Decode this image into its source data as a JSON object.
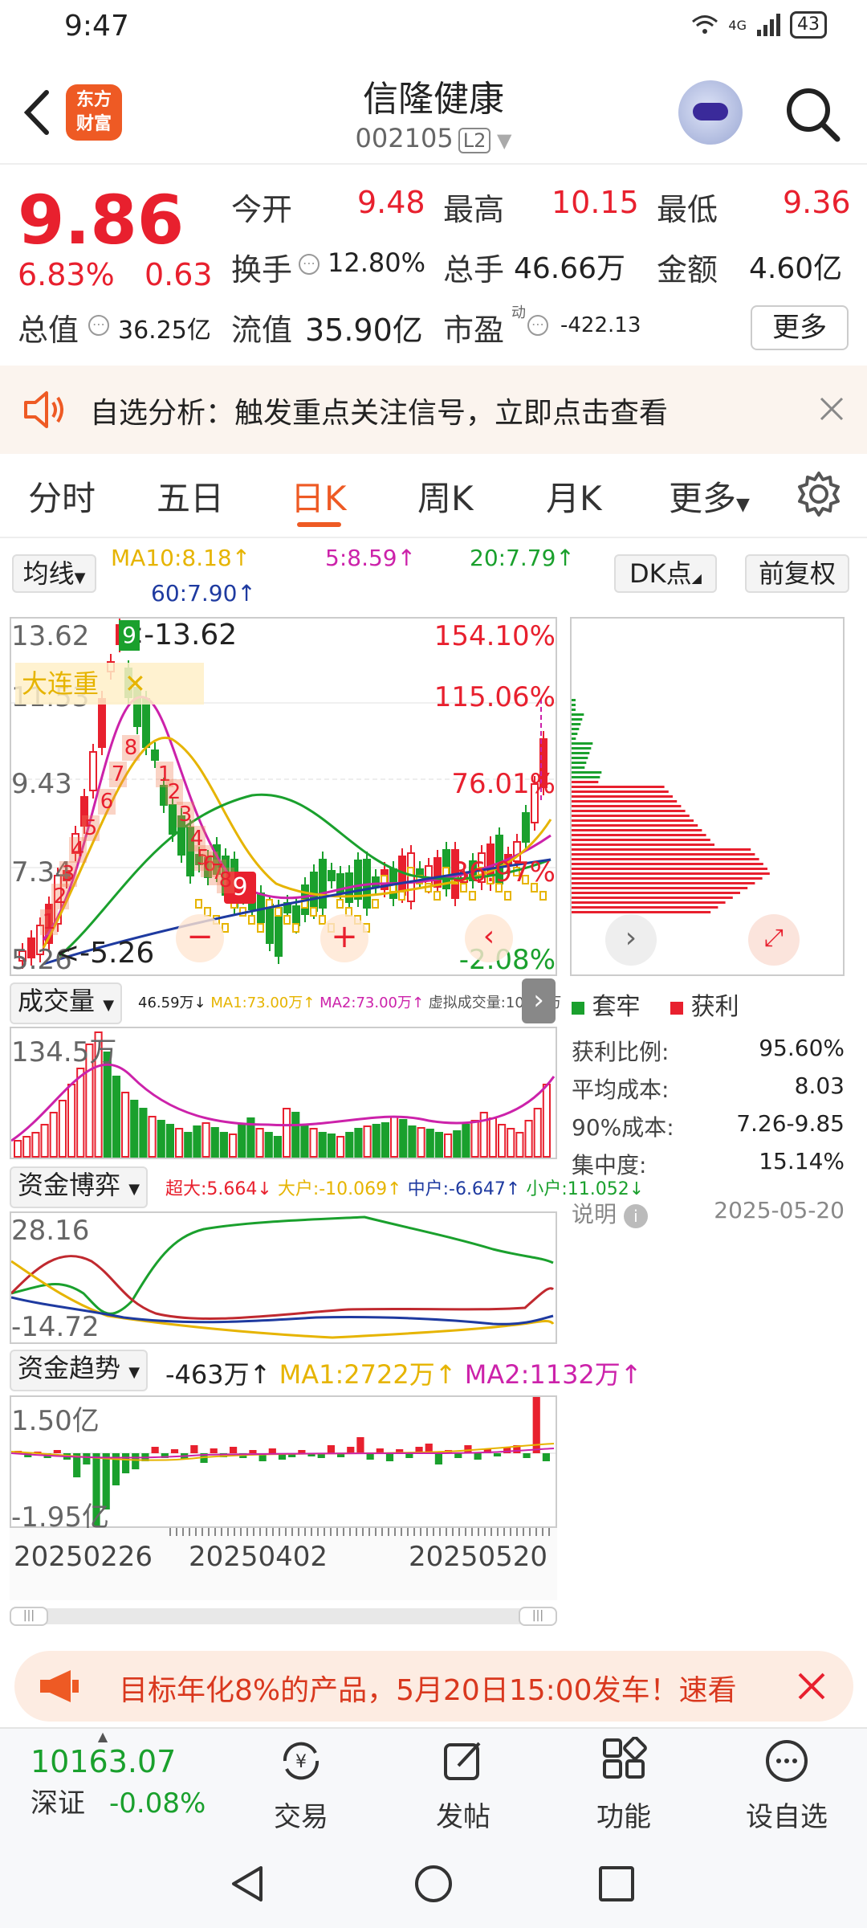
{
  "status": {
    "time": "9:47",
    "network": "4G",
    "battery": "43"
  },
  "header": {
    "logo_line1": "东方",
    "logo_line2": "财富",
    "stock_name": "信隆健康",
    "stock_code": "002105",
    "level": "L2"
  },
  "quote": {
    "price": "9.86",
    "change_pct": "6.83%",
    "change": "0.63",
    "open_label": "今开",
    "open": "9.48",
    "high_label": "最高",
    "high": "10.15",
    "low_label": "最低",
    "low": "9.36",
    "turnover_label": "换手",
    "turnover": "12.80%",
    "volume_label": "总手",
    "volume": "46.66万",
    "amount_label": "金额",
    "amount": "4.60亿",
    "mktcap_label": "总值",
    "mktcap": "36.25亿",
    "float_label": "流值",
    "float": "35.90亿",
    "pe_label": "市盈",
    "pe_sup": "动",
    "pe": "-422.13",
    "more_label": "更多"
  },
  "banner1": {
    "text": "自选分析：触发重点关注信号，立即点击查看"
  },
  "tabs": [
    "分时",
    "五日",
    "日K",
    "周K",
    "月K",
    "更多"
  ],
  "active_tab": "日K",
  "ma": {
    "selector": "均线",
    "ma10": "MA10:8.18↑",
    "ma5": "5:8.59↑",
    "ma20": "20:7.79↑",
    "ma60": "60:7.90↑",
    "dk": "DK点",
    "adjust": "前复权"
  },
  "kline": {
    "y_top": "13.62",
    "y2": "11.53",
    "y3": "9.43",
    "y4": "7.34",
    "y_bottom": "5.26",
    "max_label": "<-13.62",
    "min_label": "<-5.26",
    "pct_top": "154.10%",
    "pct2": "115.06%",
    "pct3": "76.01%",
    "pct4": "36.97%",
    "pct_bottom": "-2.08%",
    "signal_box": "大连重",
    "nine_top": "9",
    "nine_mid": "9",
    "seq_up": [
      "1",
      "2",
      "3",
      "4",
      "5",
      "6",
      "7",
      "8"
    ],
    "seq_down": [
      "1",
      "2",
      "3",
      "4",
      "5",
      "6",
      "7",
      "8"
    ]
  },
  "chips": {
    "legend_green": "套牢",
    "legend_red": "获利",
    "rows": [
      {
        "label": "获利比例:",
        "value": "95.60%"
      },
      {
        "label": "平均成本:",
        "value": "8.03"
      },
      {
        "label": "90%成本:",
        "value": "7.26-9.85"
      },
      {
        "label": "集中度:",
        "value": "15.14%"
      }
    ],
    "note_label": "说明",
    "date": "2025-05-20"
  },
  "volume": {
    "selector": "成交量",
    "v": "46.59万↓",
    "ma1": "MA1:73.00万↑",
    "ma2": "MA2:73.00万↑",
    "virtual": "虚拟成交量:107.0万",
    "y_top": "134.5万"
  },
  "fund_game": {
    "selector": "资金博弈",
    "super": "超大:5.664↓",
    "big": "大户:-10.069↑",
    "mid": "中户:-6.647↑",
    "small": "小户:11.052↓",
    "y_top": "28.16",
    "y_bottom": "-14.72"
  },
  "fund_trend": {
    "selector": "资金趋势",
    "val": "-463万↑",
    "ma1": "MA1:2722万↑",
    "ma2": "MA2:1132万↑",
    "y_top": "1.50亿",
    "y_bottom": "-1.95亿"
  },
  "dates": [
    "20250226",
    "20250402",
    "20250520"
  ],
  "banner2": {
    "text": "目标年化8%的产品，5月20日15:00发车！速看"
  },
  "bottom": {
    "index_value": "10163.07",
    "index_name": "深证",
    "index_change": "-0.08%",
    "trade": "交易",
    "post": "发帖",
    "func": "功能",
    "watch": "设自选"
  },
  "colors": {
    "up": "#e8202e",
    "down": "#1aa02d",
    "accent": "#ee5a24",
    "ma5": "#cc22aa",
    "ma10": "#e6b400",
    "ma20": "#1aa02d",
    "ma60": "#1e3aa0"
  }
}
